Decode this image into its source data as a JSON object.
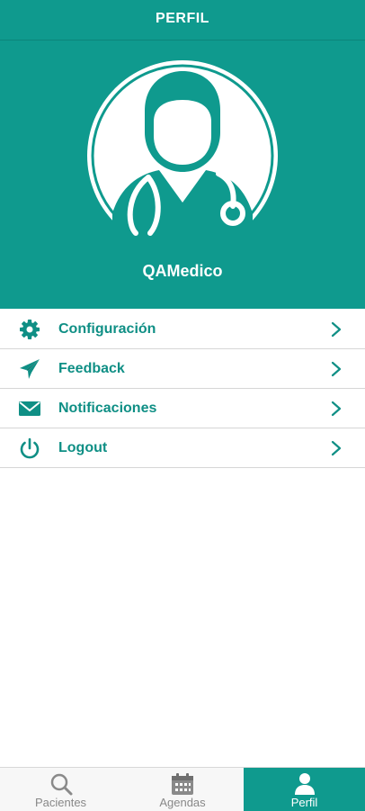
{
  "header": {
    "title": "PERFIL"
  },
  "profile": {
    "username": "QAMedico",
    "avatar_icon": "doctor-avatar-icon"
  },
  "menu": {
    "items": [
      {
        "label": "Configuración",
        "icon": "gear-icon"
      },
      {
        "label": "Feedback",
        "icon": "paper-plane-icon"
      },
      {
        "label": "Notificaciones",
        "icon": "envelope-icon"
      },
      {
        "label": "Logout",
        "icon": "power-icon"
      }
    ]
  },
  "tabbar": {
    "tabs": [
      {
        "label": "Pacientes",
        "icon": "search-icon",
        "active": false
      },
      {
        "label": "Agendas",
        "icon": "calendar-icon",
        "active": false
      },
      {
        "label": "Perfil",
        "icon": "user-icon",
        "active": true
      }
    ]
  },
  "colors": {
    "primary": "#0f9a8e",
    "menu_text": "#0f8f85",
    "tab_inactive": "#888888"
  }
}
